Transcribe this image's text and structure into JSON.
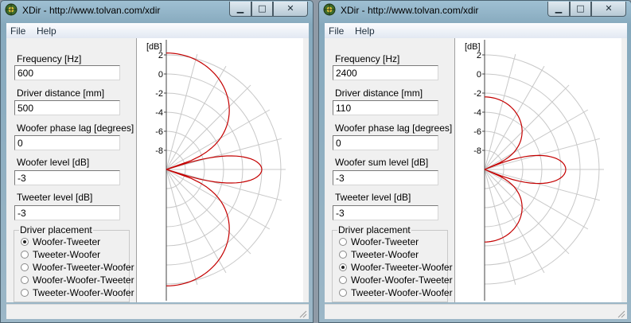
{
  "windows": [
    {
      "title": "XDir - http://www.tolvan.com/xdir",
      "menu": [
        "File",
        "Help"
      ],
      "controls": {
        "minimize": "▁",
        "maximize": "□",
        "close": "✕"
      },
      "fields": [
        {
          "label": "Frequency [Hz]",
          "value": "600"
        },
        {
          "label": "Driver distance [mm]",
          "value": "500"
        },
        {
          "label": "Woofer phase lag [degrees]",
          "value": "0"
        },
        {
          "label": "Woofer level [dB]",
          "value": "-3"
        },
        {
          "label": "Tweeter level [dB]",
          "value": "-3"
        }
      ],
      "placement": {
        "title": "Driver placement",
        "options": [
          "Woofer-Tweeter",
          "Tweeter-Woofer",
          "Woofer-Tweeter-Woofer",
          "Woofer-Woofer-Tweeter",
          "Tweeter-Woofer-Woofer"
        ],
        "selected": 0
      },
      "plot": {
        "unit": "[dB]",
        "ticks": [
          "2",
          "0",
          "-2",
          "-4",
          "-6",
          "-8"
        ],
        "tick_values": [
          2,
          0,
          -2,
          -4,
          -6,
          -8
        ],
        "curve_color": "#c40000"
      }
    },
    {
      "title": "XDir - http://www.tolvan.com/xdir",
      "menu": [
        "File",
        "Help"
      ],
      "controls": {
        "minimize": "▁",
        "maximize": "□",
        "close": "✕"
      },
      "fields": [
        {
          "label": "Frequency [Hz]",
          "value": "2400"
        },
        {
          "label": "Driver distance [mm]",
          "value": "110"
        },
        {
          "label": "Woofer phase lag [degrees]",
          "value": "0"
        },
        {
          "label": "Woofer sum level [dB]",
          "value": "-3"
        },
        {
          "label": "Tweeter level [dB]",
          "value": "-3"
        }
      ],
      "placement": {
        "title": "Driver placement",
        "options": [
          "Woofer-Tweeter",
          "Tweeter-Woofer",
          "Woofer-Tweeter-Woofer",
          "Woofer-Woofer-Tweeter",
          "Tweeter-Woofer-Woofer"
        ],
        "selected": 2
      },
      "plot": {
        "unit": "[dB]",
        "ticks": [
          "2",
          "0",
          "-2",
          "-4",
          "-6",
          "-8"
        ],
        "tick_values": [
          2,
          0,
          -2,
          -4,
          -6,
          -8
        ],
        "curve_color": "#c40000"
      }
    }
  ]
}
